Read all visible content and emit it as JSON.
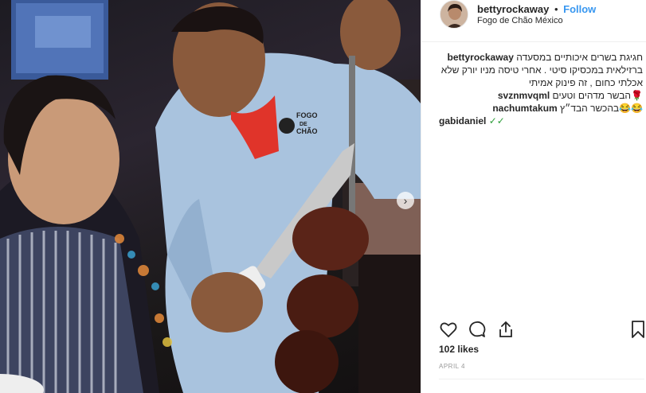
{
  "post": {
    "username": "bettyrockaway",
    "separator": "•",
    "follow_label": "Follow",
    "location": "Fogo de Chão México",
    "apron_logo_line1": "FOGO",
    "apron_logo_line2": "DE",
    "apron_logo_line3": "CHÃO"
  },
  "caption": {
    "username": "bettyrockaway",
    "text": "חגיגת בשרים איכותיים במסעדה ברזילאית במכסיקו סיטי . אחרי טיסה מניו יורק שלא אכלתי כחום , זה פינוק אמיתי"
  },
  "comments": [
    {
      "username": "svznmvqml",
      "text": "הבשר מדהים וטעים",
      "emoji": "🌹"
    },
    {
      "username": "nachumtakum",
      "text": "בהכשר הבד״ץ",
      "emoji": "😂😂"
    },
    {
      "username": "gabidaniel",
      "text": "",
      "emoji": "✓✓"
    }
  ],
  "likes_label": "102 likes",
  "date_label": "APRIL 4",
  "icons": {
    "like": "heart-icon",
    "comment": "comment-bubble-icon",
    "share": "share-icon",
    "save": "bookmark-icon",
    "carousel": "chevron-right-icon"
  }
}
